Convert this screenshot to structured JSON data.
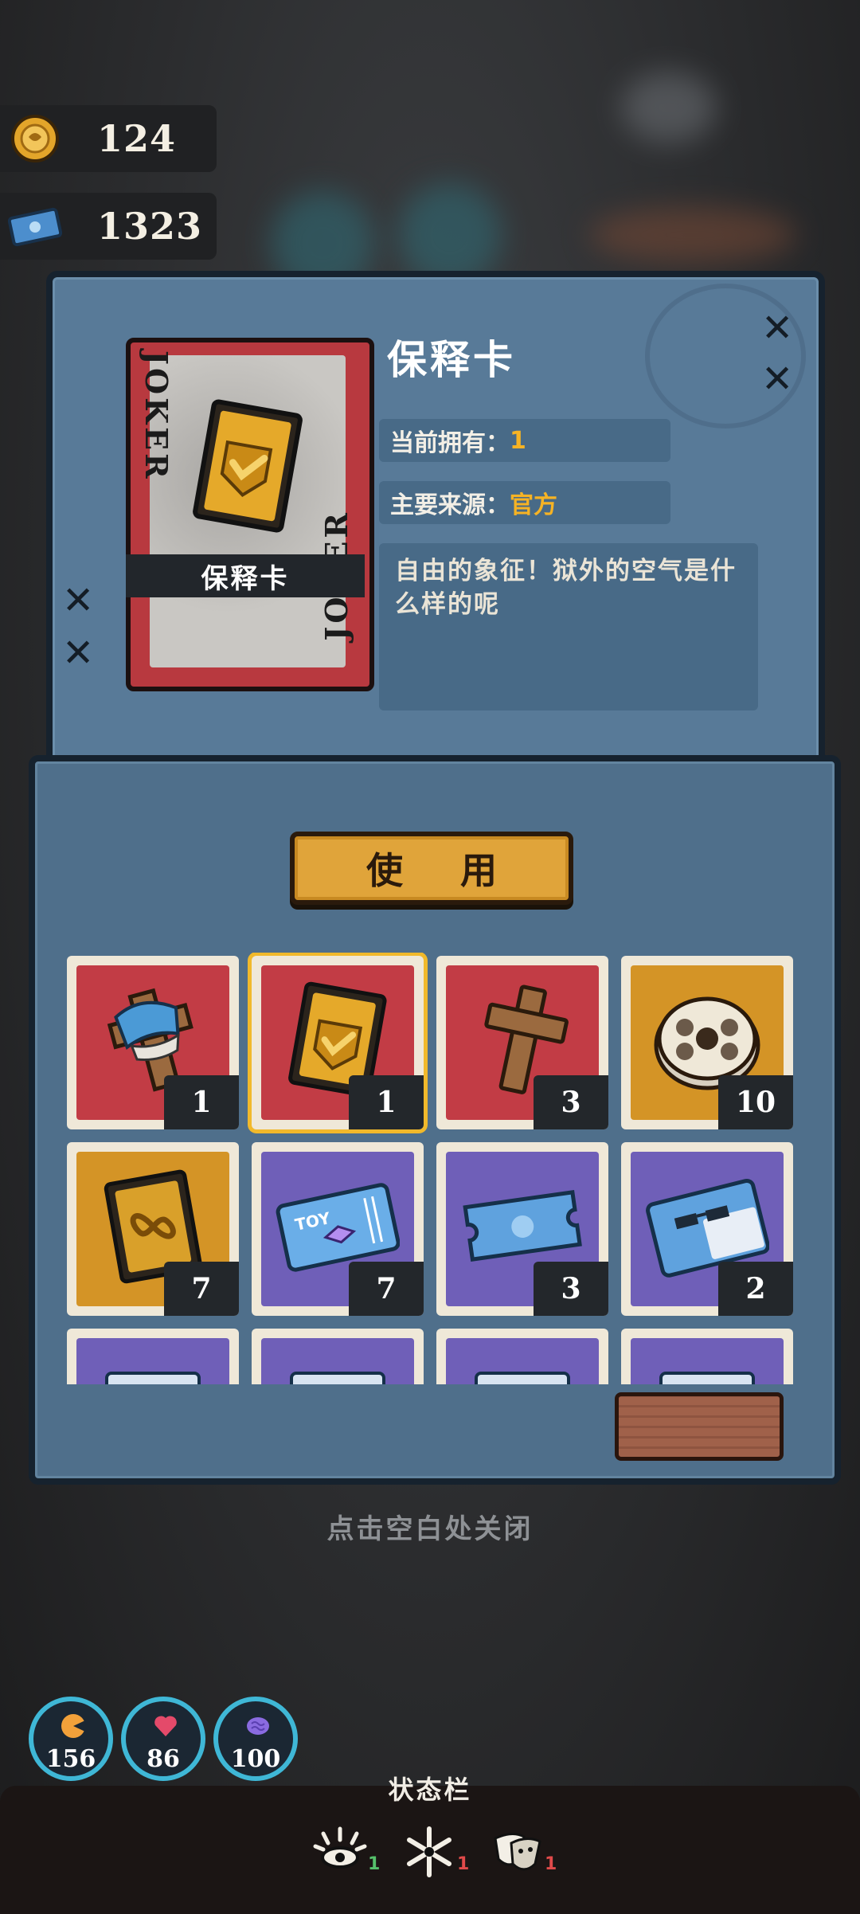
{
  "currency": {
    "coins": "124",
    "tickets": "1323"
  },
  "item": {
    "card_face_text": "JOKER",
    "card_label": "保释卡",
    "title": "保释卡",
    "owned_label": "当前拥有：",
    "owned_value": "1",
    "source_label": "主要来源：",
    "source_value": "官方",
    "description": "自由的象征！狱外的空气是什么样的呢"
  },
  "use_button": "使 用",
  "inventory": [
    {
      "count": "1",
      "bg": "red",
      "icon": "blue-bandaged-cross-icon",
      "selected": false
    },
    {
      "count": "1",
      "bg": "red",
      "icon": "bail-card-icon",
      "selected": true
    },
    {
      "count": "3",
      "bg": "red",
      "icon": "wooden-cross-icon",
      "selected": false
    },
    {
      "count": "10",
      "bg": "gold",
      "icon": "film-reel-icon",
      "selected": false
    },
    {
      "count": "7",
      "bg": "gold",
      "icon": "gold-infinity-card-icon",
      "selected": false
    },
    {
      "count": "7",
      "bg": "purple",
      "icon": "toy-ticket-icon",
      "selected": false
    },
    {
      "count": "3",
      "bg": "purple",
      "icon": "blue-ticket-icon",
      "selected": false
    },
    {
      "count": "2",
      "bg": "purple",
      "icon": "sunglasses-card-icon",
      "selected": false
    },
    {
      "count": "",
      "bg": "purple",
      "icon": "partial-item-icon",
      "selected": false
    },
    {
      "count": "",
      "bg": "purple",
      "icon": "partial-item-icon",
      "selected": false
    },
    {
      "count": "",
      "bg": "purple",
      "icon": "partial-item-icon",
      "selected": false
    },
    {
      "count": "",
      "bg": "purple",
      "icon": "partial-item-icon",
      "selected": false
    }
  ],
  "close_hint": "点击空白处关闭",
  "stats": {
    "hunger": "156",
    "health": "86",
    "sanity": "100"
  },
  "status_bar": {
    "title": "状态栏",
    "effects": [
      {
        "icon": "sun-eye-icon",
        "count": "1"
      },
      {
        "icon": "snowflake-icon",
        "count": "1"
      },
      {
        "icon": "theater-masks-icon",
        "count": "1"
      }
    ]
  }
}
